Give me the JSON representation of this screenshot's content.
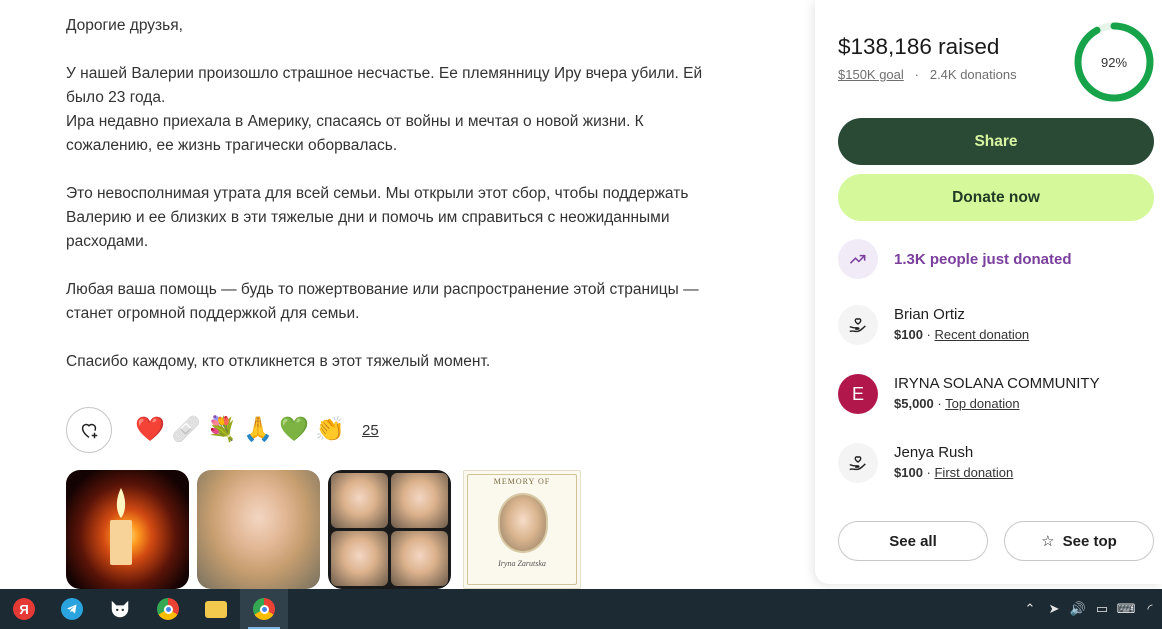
{
  "story": {
    "paragraphs": [
      "Дорогие друзья,",
      "У нашей Валерии произошло страшное несчастье. Ее племянницу Иру вчера убили. Ей\nбыло 23 года.\nИра недавно приехала в Америку, спасаясь от войны и мечтая о новой жизни. К\nсожалению, ее жизнь трагически оборвалась.",
      "Это невосполнимая утрата для всей семьи. Мы открыли этот сбор, чтобы поддержать\nВалерию и ее близких в эти тяжелые дни и помочь им справиться с неожиданными\nрасходами.",
      "Любая ваша помощь — будь то пожертвование или распространение этой страницы —\nстанет огромной поддержкой для семьи.",
      "Спасибо каждому, кто откликнется в этот тяжелый момент."
    ]
  },
  "reactions": {
    "emojis": [
      "❤️",
      "🩹",
      "💐",
      "🙏",
      "💚",
      "👏"
    ],
    "count": "25"
  },
  "gallery": {
    "memorial_title": "MEMORY OF",
    "memorial_name": "Iryna Zarutska"
  },
  "card": {
    "raised": "$138,186 raised",
    "goal": "$150K goal",
    "separator": "·",
    "donations": "2.4K donations",
    "progress_percent": "92%",
    "progress_fraction": 0.92,
    "share_label": "Share",
    "donate_label": "Donate now",
    "trend_label": "1.3K people just donated",
    "donors": [
      {
        "name": "Brian Ortiz",
        "amount": "$100",
        "sep": " · ",
        "label": "Recent donation",
        "avatar": "hand-heart-icon"
      },
      {
        "name": "IRYNA SOLANA COMMUNITY",
        "amount": "$5,000",
        "sep": " · ",
        "label": "Top donation",
        "avatar_letter": "E"
      },
      {
        "name": "Jenya Rush",
        "amount": "$100",
        "sep": " · ",
        "label": "First donation",
        "avatar": "hand-heart-icon"
      }
    ],
    "see_all_label": "See all",
    "see_top_label": "See top"
  },
  "colors": {
    "share_bg": "#2b4a35",
    "donate_bg": "#d5f89a",
    "progress": "#16a34a",
    "trend_text": "#7a3e9d",
    "avatar_e": "#b2174b"
  },
  "taskbar": {
    "apps": [
      "yandex-browser-icon",
      "telegram-icon",
      "fox-app-icon",
      "chrome-icon",
      "file-explorer-icon",
      "chrome-profile-icon"
    ],
    "tray": [
      "chevron-up-icon",
      "telegram-tray-icon",
      "volume-icon",
      "battery-icon",
      "language-icon",
      "wifi-icon"
    ]
  }
}
